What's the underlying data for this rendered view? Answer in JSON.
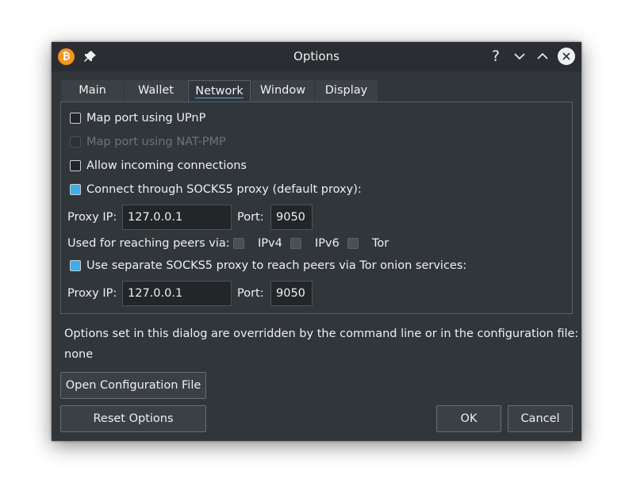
{
  "window": {
    "title": "Options",
    "app_icon_glyph": "₿",
    "help_glyph": "?",
    "accent": "#3daee9",
    "app_icon_color": "#f7931a"
  },
  "tabs": [
    {
      "label": "Main"
    },
    {
      "label": "Wallet"
    },
    {
      "label": "Network"
    },
    {
      "label": "Window"
    },
    {
      "label": "Display"
    }
  ],
  "network": {
    "upnp": {
      "label": "Map port using UPnP",
      "checked": false
    },
    "natpmp": {
      "label": "Map port using NAT-PMP",
      "checked": false,
      "enabled": false
    },
    "incoming": {
      "label": "Allow incoming connections",
      "checked": false
    },
    "socks5": {
      "label": "Connect through SOCKS5 proxy (default proxy):",
      "checked": true
    },
    "proxy1": {
      "ip_label": "Proxy IP:",
      "ip_value": "127.0.0.1",
      "port_label": "Port:",
      "port_value": "9050"
    },
    "reach": {
      "label": "Used for reaching peers via:",
      "ipv4": "IPv4",
      "ipv6": "IPv6",
      "tor": "Tor"
    },
    "tor_proxy": {
      "label": "Use separate SOCKS5 proxy to reach peers via Tor onion services:",
      "checked": true
    },
    "proxy2": {
      "ip_label": "Proxy IP:",
      "ip_value": "127.0.0.1",
      "port_label": "Port:",
      "port_value": "9050"
    }
  },
  "note": {
    "line1": "Options set in this dialog are overridden by the command line or in the configuration file:",
    "line2": "none"
  },
  "buttons": {
    "open_config": "Open Configuration File",
    "reset": "Reset Options",
    "ok": "OK",
    "cancel": "Cancel"
  }
}
